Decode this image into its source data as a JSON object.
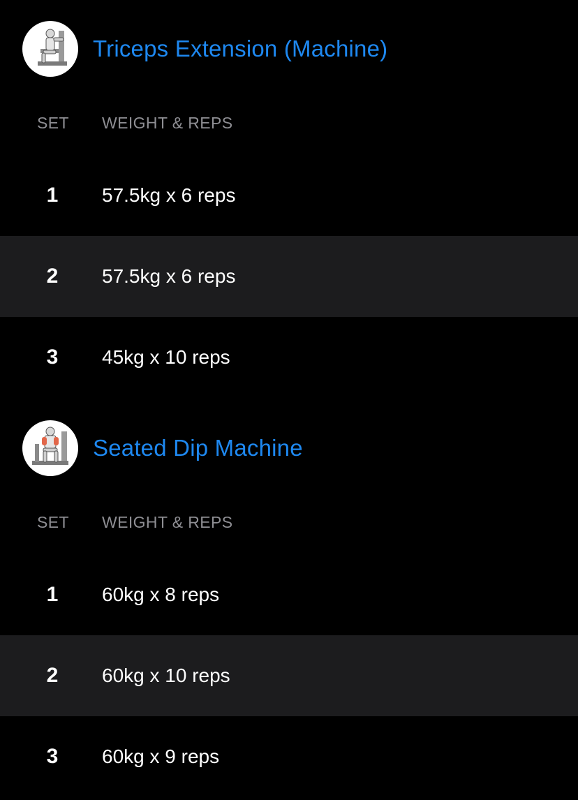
{
  "columns": {
    "set": "SET",
    "weight_reps": "WEIGHT & REPS"
  },
  "colors": {
    "title": "#1e88f0",
    "header_text": "#8e8e93",
    "row_alt": "#1c1c1e",
    "background": "#000000"
  },
  "exercises": [
    {
      "title": "Triceps Extension (Machine)",
      "thumbnail_icon": "triceps-extension-machine-thumbnail",
      "sets": [
        {
          "set": "1",
          "value": "57.5kg x 6 reps"
        },
        {
          "set": "2",
          "value": "57.5kg x 6 reps"
        },
        {
          "set": "3",
          "value": "45kg x 10 reps"
        }
      ]
    },
    {
      "title": "Seated Dip Machine",
      "thumbnail_icon": "seated-dip-machine-thumbnail",
      "sets": [
        {
          "set": "1",
          "value": "60kg x 8 reps"
        },
        {
          "set": "2",
          "value": "60kg x 10 reps"
        },
        {
          "set": "3",
          "value": "60kg x 9 reps"
        }
      ]
    }
  ]
}
